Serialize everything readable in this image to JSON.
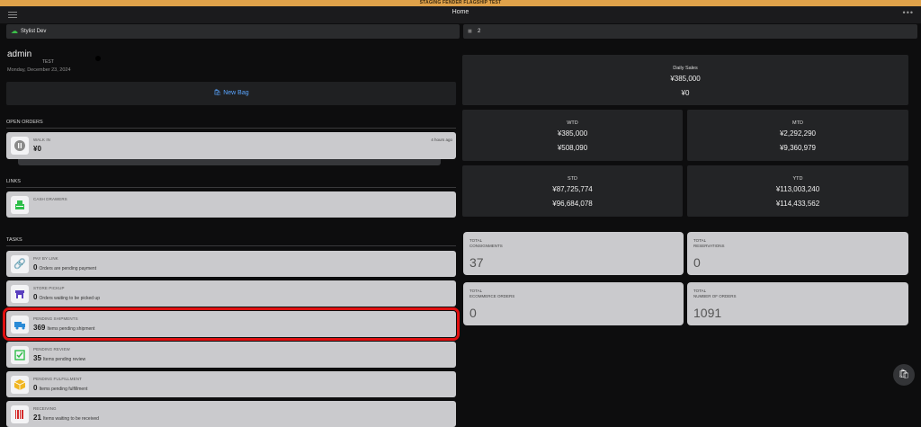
{
  "banner": "STAGING FENDER FLAGSHIP TEST",
  "nav": {
    "title": "Home",
    "more": "•••"
  },
  "store": {
    "name": "Stylist Dev",
    "count": "2"
  },
  "user": {
    "name": "admin",
    "tag": "TEST",
    "date": "Monday, December 23, 2024"
  },
  "new_bag_label": "New Bag",
  "sections": {
    "open_orders": "OPEN ORDERS",
    "links": "LINKS",
    "tasks": "TASKS"
  },
  "open_order": {
    "label": "WALK IN",
    "amount": "¥0",
    "ago": "4 hours ago"
  },
  "links": [
    {
      "label": "CASH DRAWERS"
    }
  ],
  "tasks": [
    {
      "label": "PAY BY LINK",
      "count": "0",
      "desc": "Orders are pending payment"
    },
    {
      "label": "STORE PICKUP",
      "count": "0",
      "desc": "Orders waiting to be picked up"
    },
    {
      "label": "PENDING SHIPMENTS",
      "count": "369",
      "desc": "Items pending shipment"
    },
    {
      "label": "PENDING REVIEW",
      "count": "35",
      "desc": "Items pending review"
    },
    {
      "label": "PENDING FULFILLMENT",
      "count": "0",
      "desc": "Items pending fulfillment"
    },
    {
      "label": "RECEIVING",
      "count": "21",
      "desc": "Items waiting to be received"
    }
  ],
  "sales": {
    "daily": {
      "title": "Daily Sales",
      "v1": "¥385,000",
      "v2": "¥0"
    },
    "wtd": {
      "title": "WTD",
      "v1": "¥385,000",
      "v2": "¥508,090"
    },
    "mtd": {
      "title": "MTD",
      "v1": "¥2,292,290",
      "v2": "¥9,360,979"
    },
    "std": {
      "title": "STD",
      "v1": "¥87,725,774",
      "v2": "¥96,684,078"
    },
    "ytd": {
      "title": "YTD",
      "v1": "¥113,003,240",
      "v2": "¥114,433,562"
    }
  },
  "stats": [
    {
      "line1": "TOTAL",
      "line2": "CONSIGNMENTS",
      "value": "37"
    },
    {
      "line1": "TOTAL",
      "line2": "RESERVATIONS",
      "value": "0"
    },
    {
      "line1": "TOTAL",
      "line2": "ECOMMERCE ORDERS",
      "value": "0"
    },
    {
      "line1": "TOTAL",
      "line2": "NUMBER OF ORDERS",
      "value": "1091"
    }
  ],
  "colors": {
    "accent": "#5aa5ff",
    "banner": "#e0a24a",
    "highlight": "#e01010"
  }
}
